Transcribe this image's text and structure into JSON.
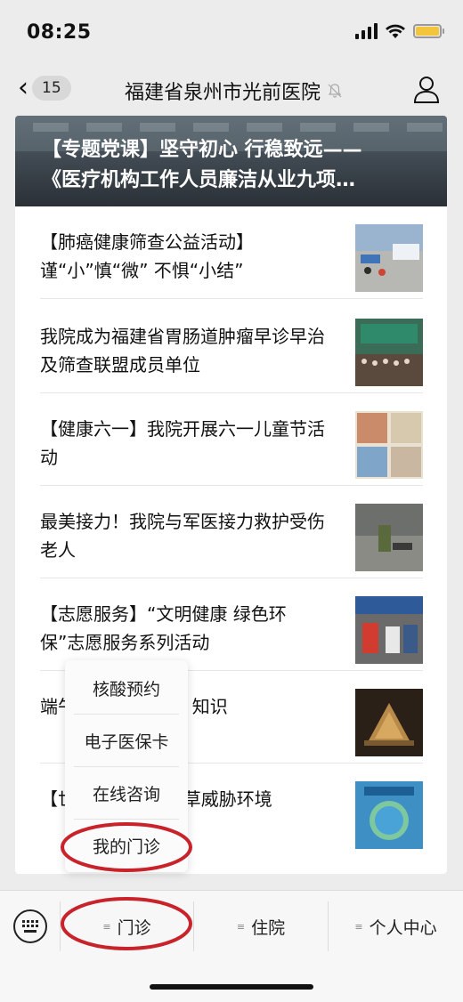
{
  "status_bar": {
    "time": "08:25"
  },
  "nav": {
    "unread_count": "15",
    "title": "福建省泉州市光前医院"
  },
  "banner": {
    "title": "【专题党课】坚守初心 行稳致远——\n《医疗机构工作人员廉洁从业九项…"
  },
  "articles": [
    {
      "title": "【肺癌健康筛查公益活动】谨“小”慎“微” 不惧“小结”"
    },
    {
      "title": "我院成为福建省胃肠道肿瘤早诊早治及筛查联盟成员单位"
    },
    {
      "title": "【健康六一】我院开展六一儿童节活动"
    },
    {
      "title": "最美接力！我院与军医接力救护受伤老人"
    },
    {
      "title": "【志愿服务】“文明健康 绿色环保”志愿服务系列活动"
    },
    {
      "title": "端午…知识",
      "visible_prefix": "端午",
      "visible_suffix": "知识"
    },
    {
      "title": "【世…烟草威胁环境",
      "visible_prefix": "【世",
      "visible_suffix": "烟草威胁环境"
    }
  ],
  "popup_menu": {
    "items": [
      "核酸预约",
      "电子医保卡",
      "在线咨询",
      "我的门诊"
    ]
  },
  "bottom_menu": {
    "tabs": [
      "门诊",
      "住院",
      "个人中心"
    ]
  },
  "colors": {
    "annotation": "#c8232b",
    "background": "#ececec",
    "battery": "#f2c53d"
  }
}
